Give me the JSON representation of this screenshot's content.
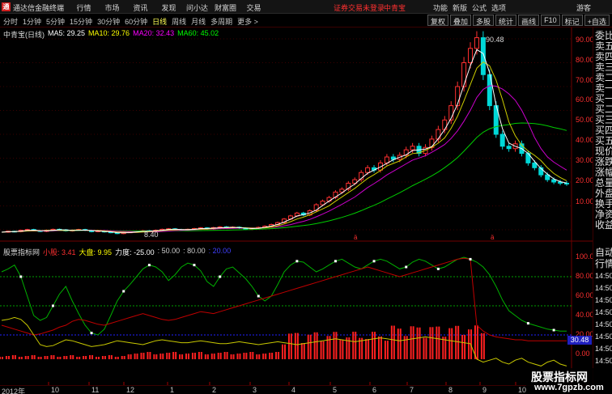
{
  "app": {
    "logo": "通",
    "title": "通达信金融终端",
    "menu": [
      "行情",
      "市场",
      "资讯",
      "发现",
      "问小达",
      "财富圈",
      "交易"
    ],
    "notice": "证券交易未登录",
    "stock": "中青宝",
    "right_menu": [
      "功能",
      "新版",
      "公式",
      "选项"
    ],
    "guest": "游客"
  },
  "toolbar": {
    "periods": [
      "分时",
      "1分钟",
      "5分钟",
      "15分钟",
      "30分钟",
      "60分钟",
      "日线",
      "周线",
      "月线",
      "多周期",
      "更多 >"
    ],
    "active_period": "日线",
    "tools": [
      "复权",
      "叠加",
      "多股",
      "统计",
      "画线",
      "F10",
      "标记",
      "+自选"
    ]
  },
  "main_legend": {
    "stock": "中青宝(日线)",
    "ma": [
      {
        "label": "MA5: 29.25",
        "color": "#ffffff"
      },
      {
        "label": "MA10: 29.76",
        "color": "#ffff00"
      },
      {
        "label": "MA20: 32.43",
        "color": "#ff00ff"
      },
      {
        "label": "MA60: 45.02",
        "color": "#00ff00"
      }
    ]
  },
  "price_axis": [
    "90.00",
    "80.00",
    "70.00",
    "60.00",
    "50.00",
    "40.00",
    "30.00",
    "20.00",
    "10.00"
  ],
  "indicator_axis": [
    "100.00",
    "80.00",
    "60.00",
    "40.00",
    "20.00",
    "0.00"
  ],
  "high_label": "90.48",
  "low_label": "8.40",
  "current_price": "30.48",
  "indicator_legend": {
    "name": "股票指标网",
    "items": [
      {
        "label": "小股: 3.41",
        "color": "#ff3030"
      },
      {
        "label": "大盘: 9.95",
        "color": "#ffff00"
      },
      {
        "label": "力度: -25.00",
        "color": "#ffffff"
      },
      {
        "label": ": 50.00",
        "color": "#cccccc"
      },
      {
        "label": ": 80.00",
        "color": "#cccccc"
      },
      {
        "label": ": 20.00",
        "color": "#4040ff"
      }
    ]
  },
  "side_panel": {
    "items": [
      "委比",
      "卖五",
      "卖四",
      "卖三",
      "卖二",
      "卖一",
      "买一",
      "买二",
      "买三",
      "买四",
      "买五",
      "现价",
      "涨跌",
      "涨幅",
      "总量",
      "外盘",
      "换手",
      "净资",
      "收益"
    ],
    "lower_title": "自动",
    "lower_sub": "行情",
    "times": [
      "14:50",
      "14:50",
      "14:50",
      "14:50",
      "14:50",
      "14:50",
      "14:50",
      "14:50"
    ]
  },
  "date_axis": [
    "2012年",
    "10",
    "11",
    "12",
    "1",
    "2",
    "3",
    "4",
    "5",
    "6",
    "7",
    "8",
    "9",
    "10"
  ],
  "watermark": {
    "top": "股票指标网",
    "bottom": "www.7gpzb.com"
  },
  "chart_data": {
    "type": "line",
    "title": "中青宝(日线)",
    "price_range": [
      8.4,
      90.48
    ],
    "price": [
      9,
      9.4,
      9.2,
      9.8,
      10.1,
      9.6,
      9.3,
      9.8,
      10.2,
      10,
      9.5,
      9.8,
      10.1,
      9.7,
      9.2,
      9.6,
      9.1,
      8.8,
      8.4,
      8.9,
      9.1,
      9.3,
      9.6,
      9.4,
      9.8,
      10.2,
      10.4,
      10.1,
      9.8,
      10.2,
      10.5,
      10.8,
      10.3,
      10.9,
      11.2,
      10.8,
      11.1,
      10.7,
      10.2,
      10.6,
      11,
      11.5,
      12.2,
      13,
      14.5,
      15.8,
      17,
      16.2,
      18,
      20.5,
      22,
      23.5,
      25.8,
      27,
      29.5,
      31,
      34,
      36,
      35,
      38,
      40.5,
      39.5,
      41.2,
      43.5,
      45,
      42,
      44.5,
      48,
      52,
      56,
      62,
      70,
      80,
      86,
      90.48,
      75,
      62,
      50,
      45,
      44,
      46,
      42,
      38,
      36,
      33,
      31,
      30,
      29.5,
      29.25
    ]
  }
}
